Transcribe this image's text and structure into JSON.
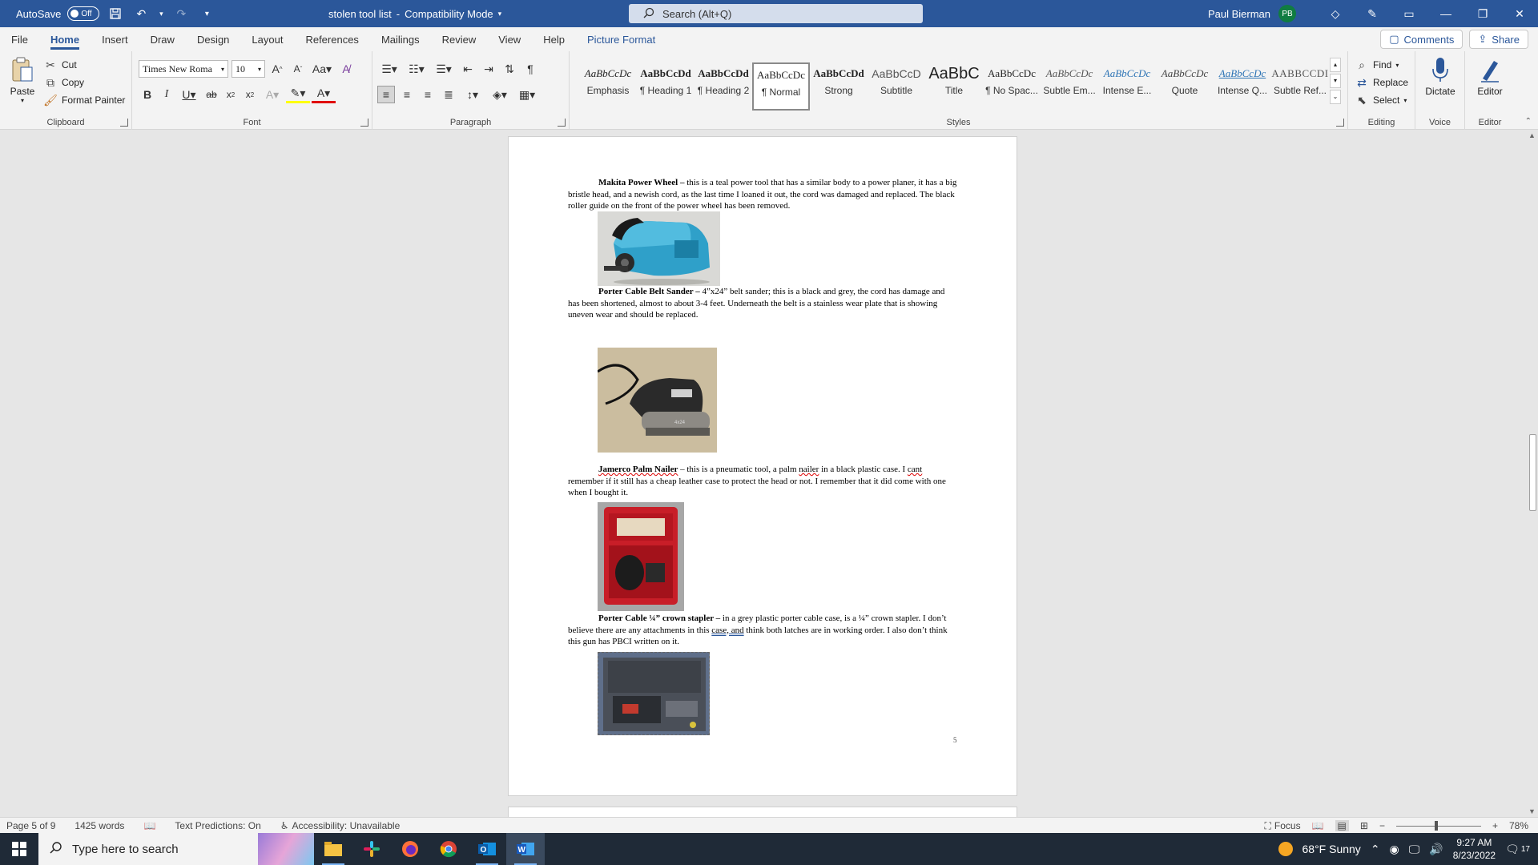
{
  "titlebar": {
    "autosave_label": "AutoSave",
    "autosave_state": "Off",
    "doc_title": "stolen tool list",
    "mode": "Compatibility Mode",
    "search_placeholder": "Search (Alt+Q)",
    "user_name": "Paul Bierman",
    "user_initials": "PB"
  },
  "tabs": [
    "File",
    "Home",
    "Insert",
    "Draw",
    "Design",
    "Layout",
    "References",
    "Mailings",
    "Review",
    "View",
    "Help",
    "Picture Format"
  ],
  "tab_actions": {
    "comments": "Comments",
    "share": "Share"
  },
  "ribbon": {
    "clipboard": {
      "paste": "Paste",
      "cut": "Cut",
      "copy": "Copy",
      "format_painter": "Format Painter",
      "label": "Clipboard"
    },
    "font": {
      "name": "Times New Roma",
      "size": "10",
      "label": "Font"
    },
    "paragraph": {
      "label": "Paragraph"
    },
    "styles": {
      "label": "Styles",
      "items": [
        {
          "preview": "AaBbCcDc",
          "name": "Emphasis"
        },
        {
          "preview": "AaBbCcDd",
          "name": "¶ Heading 1"
        },
        {
          "preview": "AaBbCcDd",
          "name": "¶ Heading 2"
        },
        {
          "preview": "AaBbCcDc",
          "name": "¶ Normal"
        },
        {
          "preview": "AaBbCcDd",
          "name": "Strong"
        },
        {
          "preview": "AaBbCcD",
          "name": "Subtitle"
        },
        {
          "preview": "AaBbC",
          "name": "Title"
        },
        {
          "preview": "AaBbCcDc",
          "name": "¶ No Spac..."
        },
        {
          "preview": "AaBbCcDc",
          "name": "Subtle Em..."
        },
        {
          "preview": "AaBbCcDc",
          "name": "Intense E..."
        },
        {
          "preview": "AaBbCcDc",
          "name": "Quote"
        },
        {
          "preview": "AaBbCcDc",
          "name": "Intense Q..."
        },
        {
          "preview": "AABBCCDI",
          "name": "Subtle Ref..."
        }
      ]
    },
    "editing": {
      "find": "Find",
      "replace": "Replace",
      "select": "Select",
      "label": "Editing"
    },
    "voice": {
      "dictate": "Dictate",
      "label": "Voice"
    },
    "editor": {
      "editor": "Editor",
      "label": "Editor"
    }
  },
  "document": {
    "p1_bold": "Makita Power Wheel –",
    "p1_text": " this is a teal power tool that has a similar body to a power planer, it has a big bristle head, and a newish cord, as the last time I loaned it out, the cord was damaged and replaced. The black roller guide on the front of the power wheel has been removed.",
    "p2_bold": "Porter Cable Belt Sander –",
    "p2_text": " 4”x24” belt sander; this is a black and grey, the cord has damage and has been shortened, almost to about 3-4 feet.  Underneath the belt is a stainless wear plate that is showing uneven wear and should be replaced.",
    "p3_bold": "Jamerco Palm Nailer",
    "p3_a": " – this is a pneumatic tool, a palm ",
    "p3_nailer": "nailer",
    "p3_b": " in a black plastic case.  I ",
    "p3_cant": "cant",
    "p3_c": " remember if it still has a cheap leather case to protect the head or not.  I remember that it did come with one when I bought it.",
    "p4_bold": "Porter Cable ¼” crown stapler –",
    "p4_a": " in a grey plastic porter cable case, is a ¼” crown stapler.  I don’t believe there are any attachments in this ",
    "p4_caseand": "case, and",
    "p4_b": " think both latches are in working order.  I also don’t think this gun has PBCI written on it.",
    "page_number": "5",
    "images": {
      "belt_sander_label": "4x24"
    }
  },
  "statusbar": {
    "page": "Page 5 of 9",
    "words": "1425 words",
    "predictions": "Text Predictions: On",
    "accessibility": "Accessibility: Unavailable",
    "focus": "Focus",
    "zoom": "78%"
  },
  "taskbar": {
    "search_placeholder": "Type here to search",
    "weather": "68°F  Sunny",
    "time": "9:27 AM",
    "date": "8/23/2022",
    "notifications": "17"
  }
}
